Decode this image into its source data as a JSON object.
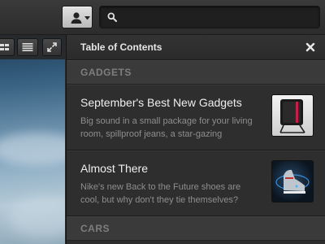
{
  "header": {
    "user_menu_icon": "user-icon",
    "user_menu_caret_icon": "caret-down-icon",
    "search_icon": "search-icon",
    "search_value": "",
    "search_placeholder": ""
  },
  "viewer": {
    "toolbar": {
      "buttons": [
        {
          "icon": "grid-view-icon"
        },
        {
          "icon": "list-view-icon"
        },
        {
          "icon": "fullscreen-icon"
        }
      ]
    }
  },
  "toc": {
    "title": "Table of Contents",
    "close_icon": "close-icon",
    "sections": [
      {
        "label": "GADGETS",
        "items": [
          {
            "title": "September's Best New Gadgets",
            "description": "Big sound in a small package for your living room, spillproof jeans, a star-gazing",
            "thumbnail_icon": "gadget-thumbnail"
          },
          {
            "title": "Almost There",
            "description": "Nike's new Back to the Future shoes are cool, but why don't they tie themselves?",
            "thumbnail_icon": "shoe-thumbnail"
          }
        ]
      },
      {
        "label": "CARS",
        "items": []
      }
    ]
  },
  "colors": {
    "panel_bg": "#2d2d2d",
    "section_bg": "#3a3a3a",
    "title_text": "#eeeeee",
    "desc_text": "#8e8e8e"
  }
}
